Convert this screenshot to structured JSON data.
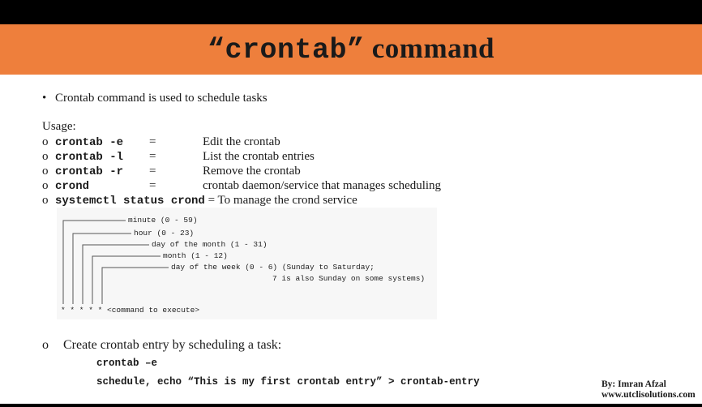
{
  "title": {
    "quote_cmd": "“crontab”",
    "word": "command"
  },
  "intro_bullet": {
    "marker": "•",
    "text": "Crontab command is used to schedule tasks"
  },
  "usage": {
    "label": "Usage:",
    "marker": "o",
    "items": [
      {
        "cmd": "crontab -e",
        "eq": "=",
        "desc": "Edit the crontab"
      },
      {
        "cmd": "crontab -l",
        "eq": "=",
        "desc": "List the crontab entries"
      },
      {
        "cmd": "crontab -r",
        "eq": "=",
        "desc": "Remove the crontab"
      },
      {
        "cmd": "crond",
        "eq": "=",
        "desc": "crontab daemon/service that manages scheduling"
      }
    ],
    "systemctl": {
      "cmd": "systemctl status crond",
      "rest": " = To manage the crond service"
    }
  },
  "diagram": {
    "labels": {
      "minute": "minute (0 - 59)",
      "hour": "hour (0 - 23)",
      "dom": "day of the month (1 - 31)",
      "month": "month (1 - 12)",
      "dow": "day of the week (0 - 6) (Sunday to Saturday;",
      "dow2": "7 is also Sunday on some systems)",
      "stars": "* * * * * <command to execute>"
    }
  },
  "create": {
    "marker": "o",
    "text": "Create crontab entry by scheduling a task:",
    "code1": "crontab –e",
    "code2": "schedule, echo “This is my first crontab entry” > crontab-entry"
  },
  "author": {
    "by": "By: Imran Afzal",
    "site": "www.utclisolutions.com"
  }
}
